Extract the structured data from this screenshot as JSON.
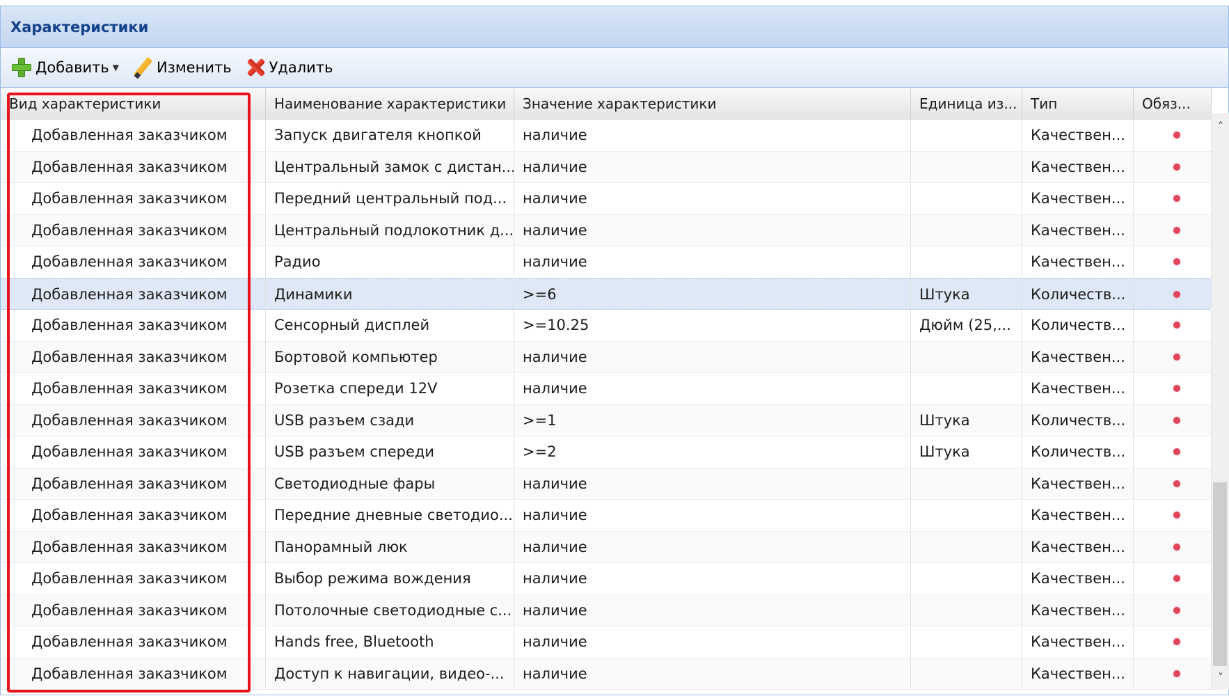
{
  "panel": {
    "title": "Характеристики"
  },
  "toolbar": {
    "add_label": "Добавить",
    "edit_label": "Изменить",
    "delete_label": "Удалить",
    "icons": {
      "add": "plus-icon",
      "edit": "pencil-icon",
      "delete": "delete-icon"
    }
  },
  "grid": {
    "columns": [
      "Вид характеристики",
      "Наименование характеристики",
      "Значение характеристики",
      "Единица из...",
      "Тип",
      "Обяз..."
    ],
    "required_dot_color": "#e0455b",
    "selected_row_color": "#dfe8f6",
    "rows": [
      {
        "kind": "Добавленная заказчиком",
        "name": "Запуск двигателя кнопкой",
        "value": "наличие",
        "unit": "",
        "type": "Качествен...",
        "required": true
      },
      {
        "kind": "Добавленная заказчиком",
        "name": "Центральный замок с дистан...",
        "value": "наличие",
        "unit": "",
        "type": "Качествен...",
        "required": true
      },
      {
        "kind": "Добавленная заказчиком",
        "name": "Передний центральный под...",
        "value": "наличие",
        "unit": "",
        "type": "Качествен...",
        "required": true
      },
      {
        "kind": "Добавленная заказчиком",
        "name": "Центральный подлокотник д...",
        "value": "наличие",
        "unit": "",
        "type": "Качествен...",
        "required": true
      },
      {
        "kind": "Добавленная заказчиком",
        "name": "Радио",
        "value": "наличие",
        "unit": "",
        "type": "Качествен...",
        "required": true
      },
      {
        "kind": "Добавленная заказчиком",
        "name": "Динамики",
        "value": ">=6",
        "unit": "Штука",
        "type": "Количеств...",
        "required": true,
        "selected": true
      },
      {
        "kind": "Добавленная заказчиком",
        "name": "Сенсорный дисплей",
        "value": ">=10.25",
        "unit": "Дюйм (25,...",
        "type": "Количеств...",
        "required": true
      },
      {
        "kind": "Добавленная заказчиком",
        "name": "Бортовой компьютер",
        "value": "наличие",
        "unit": "",
        "type": "Качествен...",
        "required": true
      },
      {
        "kind": "Добавленная заказчиком",
        "name": "Розетка спереди 12V",
        "value": "наличие",
        "unit": "",
        "type": "Качествен...",
        "required": true
      },
      {
        "kind": "Добавленная заказчиком",
        "name": "USB разъем сзади",
        "value": ">=1",
        "unit": "Штука",
        "type": "Количеств...",
        "required": true
      },
      {
        "kind": "Добавленная заказчиком",
        "name": "USB разъем спереди",
        "value": ">=2",
        "unit": "Штука",
        "type": "Количеств...",
        "required": true
      },
      {
        "kind": "Добавленная заказчиком",
        "name": "Светодиодные фары",
        "value": "наличие",
        "unit": "",
        "type": "Качествен...",
        "required": true
      },
      {
        "kind": "Добавленная заказчиком",
        "name": "Передние дневные светодио...",
        "value": "наличие",
        "unit": "",
        "type": "Качествен...",
        "required": true
      },
      {
        "kind": "Добавленная заказчиком",
        "name": "Панорамный люк",
        "value": "наличие",
        "unit": "",
        "type": "Качествен...",
        "required": true
      },
      {
        "kind": "Добавленная заказчиком",
        "name": "Выбор режима вождения",
        "value": "наличие",
        "unit": "",
        "type": "Качествен...",
        "required": true
      },
      {
        "kind": "Добавленная заказчиком",
        "name": "Потолочные светодиодные с...",
        "value": "наличие",
        "unit": "",
        "type": "Качествен...",
        "required": true
      },
      {
        "kind": "Добавленная заказчиком",
        "name": "Hands free, Bluetooth",
        "value": "наличие",
        "unit": "",
        "type": "Качествен...",
        "required": true
      },
      {
        "kind": "Добавленная заказчиком",
        "name": "Доступ к навигации, видео-...",
        "value": "наличие",
        "unit": "",
        "type": "Качествен...",
        "required": true
      }
    ]
  },
  "highlight": {
    "color": "#e8121a",
    "target": "Вид характеристики column"
  }
}
